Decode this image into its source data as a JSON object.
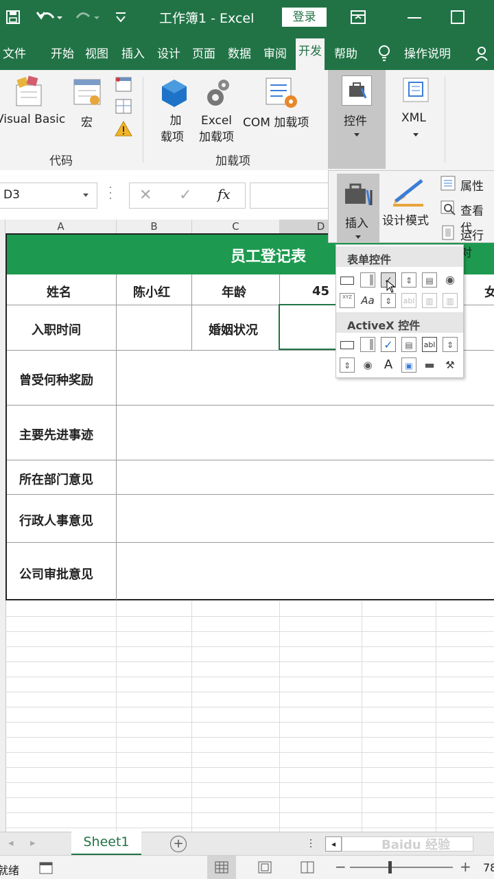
{
  "titlebar": {
    "save_icon": "save-icon",
    "undo_icon": "undo-icon",
    "redo_icon": "redo-icon",
    "customize_icon": "customize-icon",
    "title": "工作簿1  -  Excel",
    "login": "登录",
    "restore_icon": "ribbon-display-icon",
    "maximize_icon": "maximize-icon"
  },
  "tabs": [
    "文件",
    "开始",
    "视图",
    "插入",
    "设计",
    "页面",
    "数据",
    "审阅",
    "开发",
    "帮助",
    "操作说明"
  ],
  "active_tab": "开发",
  "ribbon": {
    "code": {
      "group_label": "代码",
      "visual_basic": "Visual Basic",
      "macro": "宏"
    },
    "addins": {
      "group_label": "加载项",
      "addin_1": "加",
      "addin_2": "载项",
      "excel_addin_1": "Excel",
      "excel_addin_2": "加载项",
      "com_addin": "COM 加载项"
    },
    "controls": {
      "label": "控件"
    },
    "xml": {
      "label": "XML"
    }
  },
  "controls_panel": {
    "insert": "插入",
    "design_mode": "设计模式",
    "properties": "属性",
    "view_code": "查看代",
    "run_dialog": "运行对"
  },
  "control_popup": {
    "form_controls_header": "表单控件",
    "activex_header": "ActiveX 控件",
    "text_abl": "abl",
    "text_xyz": "XYZ",
    "text_aa": "Aa",
    "text_a": "A"
  },
  "formula_bar": {
    "name_box": "D3",
    "cancel": "✕",
    "enter": "✓",
    "fx": "fx"
  },
  "columns": [
    "A",
    "B",
    "C",
    "D"
  ],
  "sheet": {
    "title": "员工登记表",
    "name_label": "姓名",
    "name_value": "陈小红",
    "age_label": "年龄",
    "age_value": "45",
    "gender_value": "女",
    "hire_date_label": "入职时间",
    "marital_label": "婚姻状况",
    "awards_label": "曾受何种奖励",
    "deeds_label": "主要先进事迹",
    "dept_opinion_label": "所在部门意见",
    "admin_opinion_label": "行政人事意见",
    "company_opinion_label": "公司审批意见"
  },
  "sheet_tabs": [
    "Sheet1"
  ],
  "status": {
    "ready": "就绪",
    "zoom": "78"
  },
  "watermark": "Baidu 经验",
  "colors": {
    "excel_green": "#217346",
    "header_fill": "#1e9a50",
    "ribbon_bg": "#f3f3f3"
  }
}
